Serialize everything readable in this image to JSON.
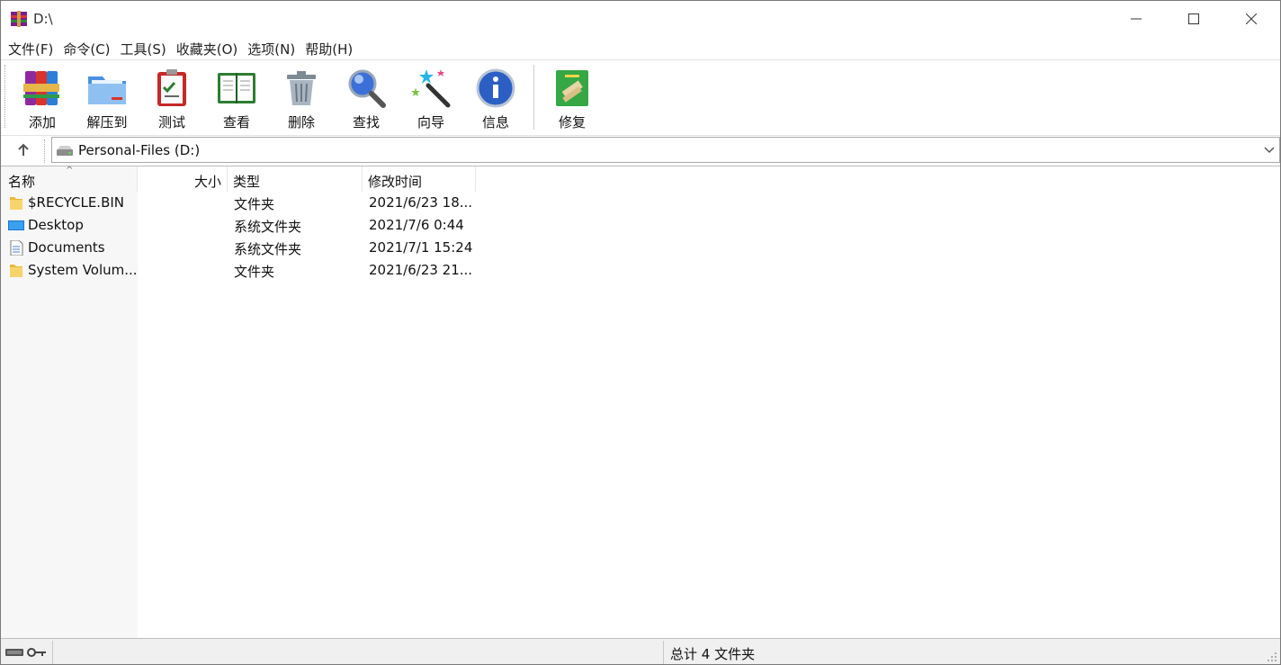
{
  "window": {
    "title": "D:\\"
  },
  "menu": [
    "文件(F)",
    "命令(C)",
    "工具(S)",
    "收藏夹(O)",
    "选项(N)",
    "帮助(H)"
  ],
  "toolbar": {
    "add": "添加",
    "extract": "解压到",
    "test": "测试",
    "view": "查看",
    "delete": "删除",
    "find": "查找",
    "wizard": "向导",
    "info": "信息",
    "repair": "修复"
  },
  "address": {
    "path": "Personal-Files (D:)"
  },
  "columns": {
    "name": "名称",
    "size": "大小",
    "type": "类型",
    "modified": "修改时间"
  },
  "files": [
    {
      "name": "$RECYCLE.BIN",
      "size": "",
      "type": "文件夹",
      "modified": "2021/6/23 18...",
      "icon": "folder-icon"
    },
    {
      "name": "Desktop",
      "size": "",
      "type": "系统文件夹",
      "modified": "2021/7/6 0:44",
      "icon": "desktop-icon"
    },
    {
      "name": "Documents",
      "size": "",
      "type": "系统文件夹",
      "modified": "2021/7/1 15:24",
      "icon": "document-icon"
    },
    {
      "name": "System Volum...",
      "size": "",
      "type": "文件夹",
      "modified": "2021/6/23 21...",
      "icon": "folder-icon"
    }
  ],
  "status": {
    "summary": "总计 4 文件夹"
  },
  "colors": {
    "accent": "#1e73d2",
    "folder": "#f2c94c"
  }
}
